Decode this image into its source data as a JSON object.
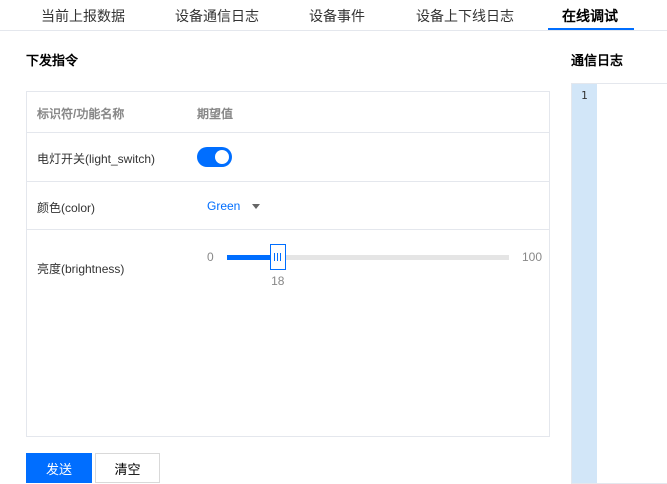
{
  "tabs": [
    {
      "label": "当前上报数据",
      "active": false
    },
    {
      "label": "设备通信日志",
      "active": false
    },
    {
      "label": "设备事件",
      "active": false
    },
    {
      "label": "设备上下线日志",
      "active": false
    },
    {
      "label": "在线调试",
      "active": true
    }
  ],
  "command_panel": {
    "title": "下发指令",
    "table": {
      "header": {
        "identifier": "标识符/功能名称",
        "expected": "期望值"
      },
      "rows": [
        {
          "label": "电灯开关(light_switch)",
          "control": "toggle",
          "value": true
        },
        {
          "label": "颜色(color)",
          "control": "select",
          "value": "Green"
        },
        {
          "label": "亮度(brightness)",
          "control": "slider",
          "min": "0",
          "max": "100",
          "value": "18",
          "fraction": 0.18
        }
      ]
    },
    "buttons": {
      "send": "发送",
      "clear": "清空"
    }
  },
  "log_panel": {
    "title": "通信日志",
    "line_numbers": [
      "1"
    ]
  },
  "colors": {
    "accent": "#006eff",
    "border": "#e4e7ed",
    "gutter": "#d2e6f8"
  }
}
